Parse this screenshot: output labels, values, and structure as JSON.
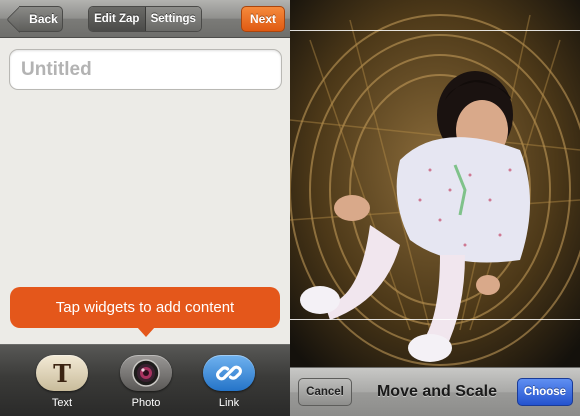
{
  "editor": {
    "navbar": {
      "back_label": "Back",
      "tabs": [
        {
          "label": "Edit Zap",
          "active": true
        },
        {
          "label": "Settings",
          "active": false
        }
      ],
      "next_label": "Next"
    },
    "title_field": {
      "placeholder": "Untitled"
    },
    "hint": "Tap widgets to add content",
    "widgets": [
      {
        "label": "Text",
        "icon": "text-icon"
      },
      {
        "label": "Photo",
        "icon": "camera-lens-icon"
      },
      {
        "label": "Link",
        "icon": "chain-link-icon"
      }
    ]
  },
  "photo_picker": {
    "cancel_label": "Cancel",
    "title": "Move and Scale",
    "choose_label": "Choose"
  },
  "colors": {
    "accent_orange": "#e4571b",
    "choose_blue": "#2453cf"
  }
}
